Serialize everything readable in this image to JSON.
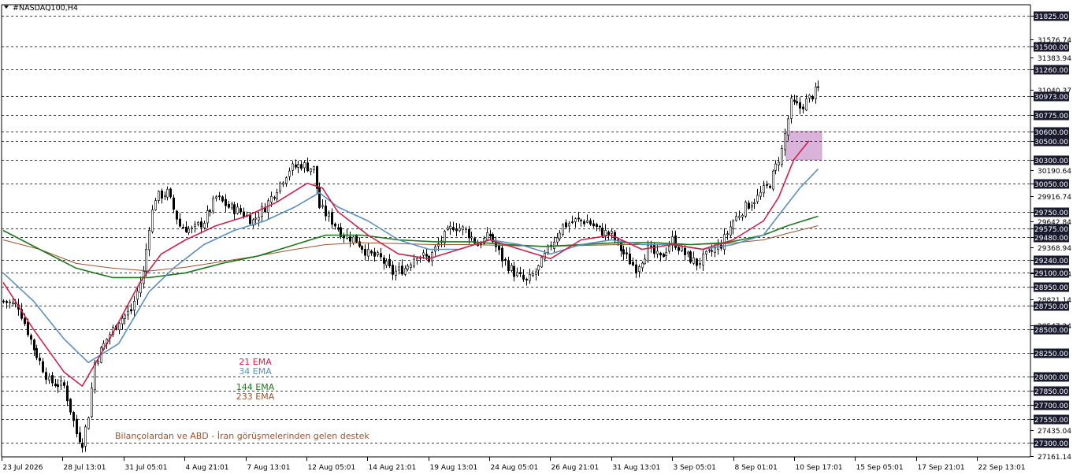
{
  "chart_data": {
    "type": "candlestick",
    "symbol_label": "#NASDAQ100,H4",
    "ylim": [
      27161.14,
      31950
    ],
    "price_ticks": [
      "31576.74",
      "31383.94",
      "30190.64",
      "29916.74",
      "29642.84",
      "29368.94",
      "29095.04",
      "28821.14",
      "28547.24",
      "27435.04",
      "27161.14"
    ],
    "horizontal_levels": [
      31825.0,
      31500.0,
      31260.0,
      30973.0,
      30775.0,
      30600.0,
      30500.0,
      30300.0,
      30050.0,
      29750.0,
      29575.0,
      29480.0,
      29240.0,
      29100.0,
      28950.0,
      28750.0,
      28500.0,
      28250.0,
      28000.0,
      27850.0,
      27700.0,
      27550.0,
      27300.0
    ],
    "level_labels": [
      "31825.00",
      "31500.00",
      "31260.00",
      "30973.00",
      "30775.00",
      "30600.00",
      "30500.00",
      "30300.00",
      "30050.00",
      "29750.00",
      "29575.00",
      "29480.00",
      "29240.00",
      "29100.00",
      "28950.00",
      "28750.00",
      "28500.00",
      "28250.00",
      "28000.00",
      "27850.00",
      "27700.00",
      "27550.00",
      "27300.00"
    ],
    "current_price_label": "31040.37",
    "x_labels": [
      "23 Jul 2026",
      "28 Jul 13:01",
      "31 Jul 05:01",
      "4 Aug 21:01",
      "7 Aug 13:01",
      "12 Aug 05:01",
      "14 Aug 21:01",
      "19 Aug 13:01",
      "24 Aug 05:01",
      "26 Aug 21:01",
      "31 Aug 13:01",
      "3 Sep 05:01",
      "8 Sep 01:01",
      "10 Sep 17:01",
      "15 Sep 05:01",
      "17 Sep 21:01",
      "22 Sep 13:01"
    ],
    "key_closes": [
      [
        0,
        28800
      ],
      [
        5,
        28750
      ],
      [
        10,
        28300
      ],
      [
        15,
        27950
      ],
      [
        20,
        27900
      ],
      [
        24,
        27400
      ],
      [
        26,
        27300
      ],
      [
        28,
        27600
      ],
      [
        30,
        28150
      ],
      [
        34,
        28400
      ],
      [
        38,
        28600
      ],
      [
        42,
        28700
      ],
      [
        46,
        29100
      ],
      [
        48,
        29600
      ],
      [
        50,
        29900
      ],
      [
        54,
        29950
      ],
      [
        58,
        29600
      ],
      [
        62,
        29550
      ],
      [
        66,
        29650
      ],
      [
        70,
        29900
      ],
      [
        74,
        29800
      ],
      [
        78,
        29750
      ],
      [
        82,
        29650
      ],
      [
        86,
        29800
      ],
      [
        90,
        30000
      ],
      [
        94,
        30200
      ],
      [
        98,
        30250
      ],
      [
        102,
        30200
      ],
      [
        104,
        29800
      ],
      [
        108,
        29650
      ],
      [
        112,
        29500
      ],
      [
        116,
        29450
      ],
      [
        120,
        29300
      ],
      [
        124,
        29250
      ],
      [
        128,
        29100
      ],
      [
        132,
        29150
      ],
      [
        136,
        29300
      ],
      [
        140,
        29250
      ],
      [
        144,
        29450
      ],
      [
        148,
        29600
      ],
      [
        152,
        29550
      ],
      [
        156,
        29400
      ],
      [
        160,
        29500
      ],
      [
        164,
        29250
      ],
      [
        168,
        29100
      ],
      [
        172,
        29000
      ],
      [
        176,
        29150
      ],
      [
        180,
        29400
      ],
      [
        184,
        29600
      ],
      [
        188,
        29650
      ],
      [
        192,
        29650
      ],
      [
        196,
        29550
      ],
      [
        200,
        29500
      ],
      [
        204,
        29300
      ],
      [
        208,
        29150
      ],
      [
        212,
        29350
      ],
      [
        216,
        29250
      ],
      [
        220,
        29450
      ],
      [
        224,
        29300
      ],
      [
        228,
        29200
      ],
      [
        232,
        29300
      ],
      [
        236,
        29400
      ],
      [
        240,
        29650
      ],
      [
        244,
        29800
      ],
      [
        248,
        29900
      ],
      [
        252,
        30050
      ],
      [
        256,
        30400
      ],
      [
        259,
        30900
      ],
      [
        262,
        30850
      ],
      [
        265,
        30950
      ],
      [
        268,
        31050
      ]
    ],
    "ema_21": [
      [
        0,
        29000
      ],
      [
        10,
        28500
      ],
      [
        20,
        28050
      ],
      [
        26,
        27900
      ],
      [
        35,
        28400
      ],
      [
        45,
        29000
      ],
      [
        52,
        29300
      ],
      [
        60,
        29450
      ],
      [
        70,
        29600
      ],
      [
        80,
        29700
      ],
      [
        90,
        29850
      ],
      [
        100,
        30050
      ],
      [
        105,
        30000
      ],
      [
        110,
        29750
      ],
      [
        120,
        29500
      ],
      [
        130,
        29300
      ],
      [
        140,
        29250
      ],
      [
        150,
        29350
      ],
      [
        160,
        29450
      ],
      [
        170,
        29350
      ],
      [
        180,
        29250
      ],
      [
        190,
        29450
      ],
      [
        200,
        29500
      ],
      [
        210,
        29350
      ],
      [
        220,
        29400
      ],
      [
        230,
        29350
      ],
      [
        240,
        29450
      ],
      [
        250,
        29650
      ],
      [
        255,
        29900
      ],
      [
        260,
        30300
      ],
      [
        265,
        30500
      ]
    ],
    "ema_34": [
      [
        0,
        29100
      ],
      [
        10,
        28800
      ],
      [
        20,
        28400
      ],
      [
        28,
        28150
      ],
      [
        38,
        28350
      ],
      [
        48,
        28900
      ],
      [
        56,
        29150
      ],
      [
        66,
        29400
      ],
      [
        76,
        29550
      ],
      [
        86,
        29650
      ],
      [
        96,
        29800
      ],
      [
        104,
        29950
      ],
      [
        110,
        29800
      ],
      [
        120,
        29650
      ],
      [
        130,
        29450
      ],
      [
        140,
        29350
      ],
      [
        150,
        29350
      ],
      [
        160,
        29450
      ],
      [
        170,
        29400
      ],
      [
        180,
        29300
      ],
      [
        190,
        29400
      ],
      [
        200,
        29450
      ],
      [
        210,
        29400
      ],
      [
        220,
        29400
      ],
      [
        230,
        29350
      ],
      [
        240,
        29400
      ],
      [
        250,
        29500
      ],
      [
        256,
        29750
      ],
      [
        262,
        30000
      ],
      [
        268,
        30200
      ]
    ],
    "ema_144": [
      [
        0,
        29550
      ],
      [
        12,
        29350
      ],
      [
        24,
        29150
      ],
      [
        36,
        29050
      ],
      [
        48,
        29050
      ],
      [
        60,
        29100
      ],
      [
        72,
        29200
      ],
      [
        84,
        29280
      ],
      [
        96,
        29400
      ],
      [
        106,
        29500
      ],
      [
        118,
        29500
      ],
      [
        130,
        29450
      ],
      [
        142,
        29430
      ],
      [
        154,
        29430
      ],
      [
        166,
        29400
      ],
      [
        178,
        29380
      ],
      [
        190,
        29400
      ],
      [
        202,
        29420
      ],
      [
        214,
        29420
      ],
      [
        226,
        29400
      ],
      [
        238,
        29420
      ],
      [
        250,
        29500
      ],
      [
        258,
        29600
      ],
      [
        268,
        29700
      ]
    ],
    "ema_233": [
      [
        0,
        29450
      ],
      [
        12,
        29350
      ],
      [
        24,
        29200
      ],
      [
        36,
        29150
      ],
      [
        48,
        29120
      ],
      [
        60,
        29160
      ],
      [
        72,
        29220
      ],
      [
        84,
        29280
      ],
      [
        96,
        29350
      ],
      [
        106,
        29400
      ],
      [
        118,
        29420
      ],
      [
        130,
        29410
      ],
      [
        142,
        29400
      ],
      [
        154,
        29400
      ],
      [
        166,
        29390
      ],
      [
        178,
        29380
      ],
      [
        190,
        29390
      ],
      [
        202,
        29400
      ],
      [
        214,
        29400
      ],
      [
        226,
        29400
      ],
      [
        238,
        29410
      ],
      [
        250,
        29450
      ],
      [
        258,
        29520
      ],
      [
        268,
        29600
      ]
    ],
    "supply_zone": {
      "from_price": 30300.0,
      "to_price": 30600.0
    },
    "legend": [
      {
        "label": "21 EMA",
        "color": "#d0204a"
      },
      {
        "label": "34 EMA",
        "color": "#5b8fc0"
      },
      {
        "label": "144 EMA",
        "color": "#1b7a1b"
      },
      {
        "label": "233 EMA",
        "color": "#a0522d"
      }
    ],
    "annotation": "Bilançolardan ve ABD - İran görüşmelerinden gelen destek",
    "colors": {
      "candle": "#000000",
      "zone": "#d9b3d9",
      "level_box": "#1a1a2e",
      "annotation": "#a0522d"
    }
  }
}
